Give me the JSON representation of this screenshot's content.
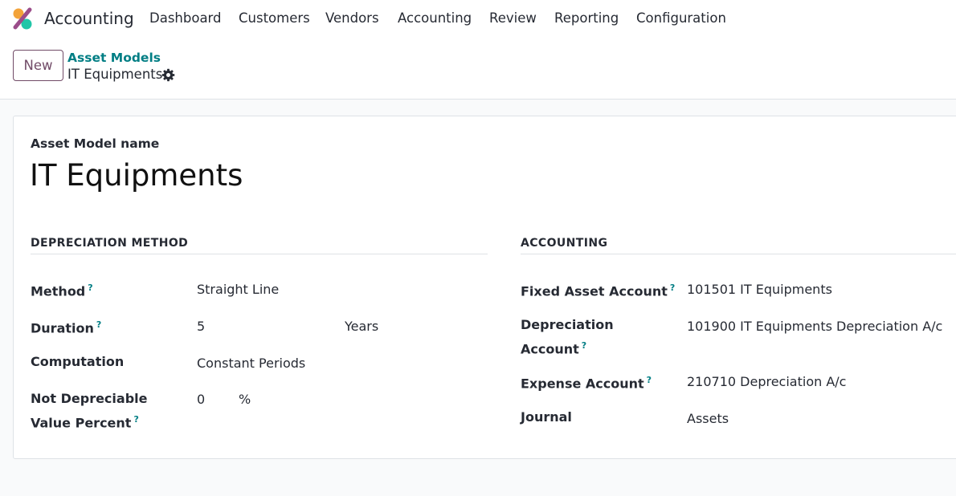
{
  "header": {
    "app_name": "Accounting",
    "logo_icon": "accounting-logo-icon",
    "nav": [
      "Dashboard",
      "Customers",
      "Vendors",
      "Accounting",
      "Review",
      "Reporting",
      "Configuration"
    ]
  },
  "control": {
    "new_label": "New",
    "breadcrumb_parent": "Asset Models",
    "breadcrumb_current": "IT Equipments",
    "gear_icon": "gear-icon"
  },
  "form": {
    "name_label": "Asset Model name",
    "name_value": "IT Equipments",
    "help_mark": "?",
    "depreciation": {
      "title": "DEPRECIATION METHOD",
      "method_label": "Method",
      "method_value": "Straight Line",
      "duration_label": "Duration",
      "duration_value": "5",
      "duration_unit": "Years",
      "computation_label": "Computation",
      "computation_value": "Constant Periods",
      "ndv_label": "Not Depreciable Value Percent",
      "ndv_value": "0",
      "ndv_unit": "%"
    },
    "accounting": {
      "title": "ACCOUNTING",
      "fixed_label": "Fixed Asset Account",
      "fixed_value": "101501 IT Equipments",
      "depr_label": "Depreciation Account",
      "depr_value": "101900 IT Equipments Depreciation A/c",
      "expense_label": "Expense Account",
      "expense_value": "210710 Depreciation A/c",
      "journal_label": "Journal",
      "journal_value": "Assets"
    }
  },
  "colors": {
    "brand": "#714b67",
    "link": "#017e84",
    "logo_orange": "#f3a33a",
    "logo_purple": "#9b4d8a",
    "logo_teal": "#21c6a8"
  }
}
